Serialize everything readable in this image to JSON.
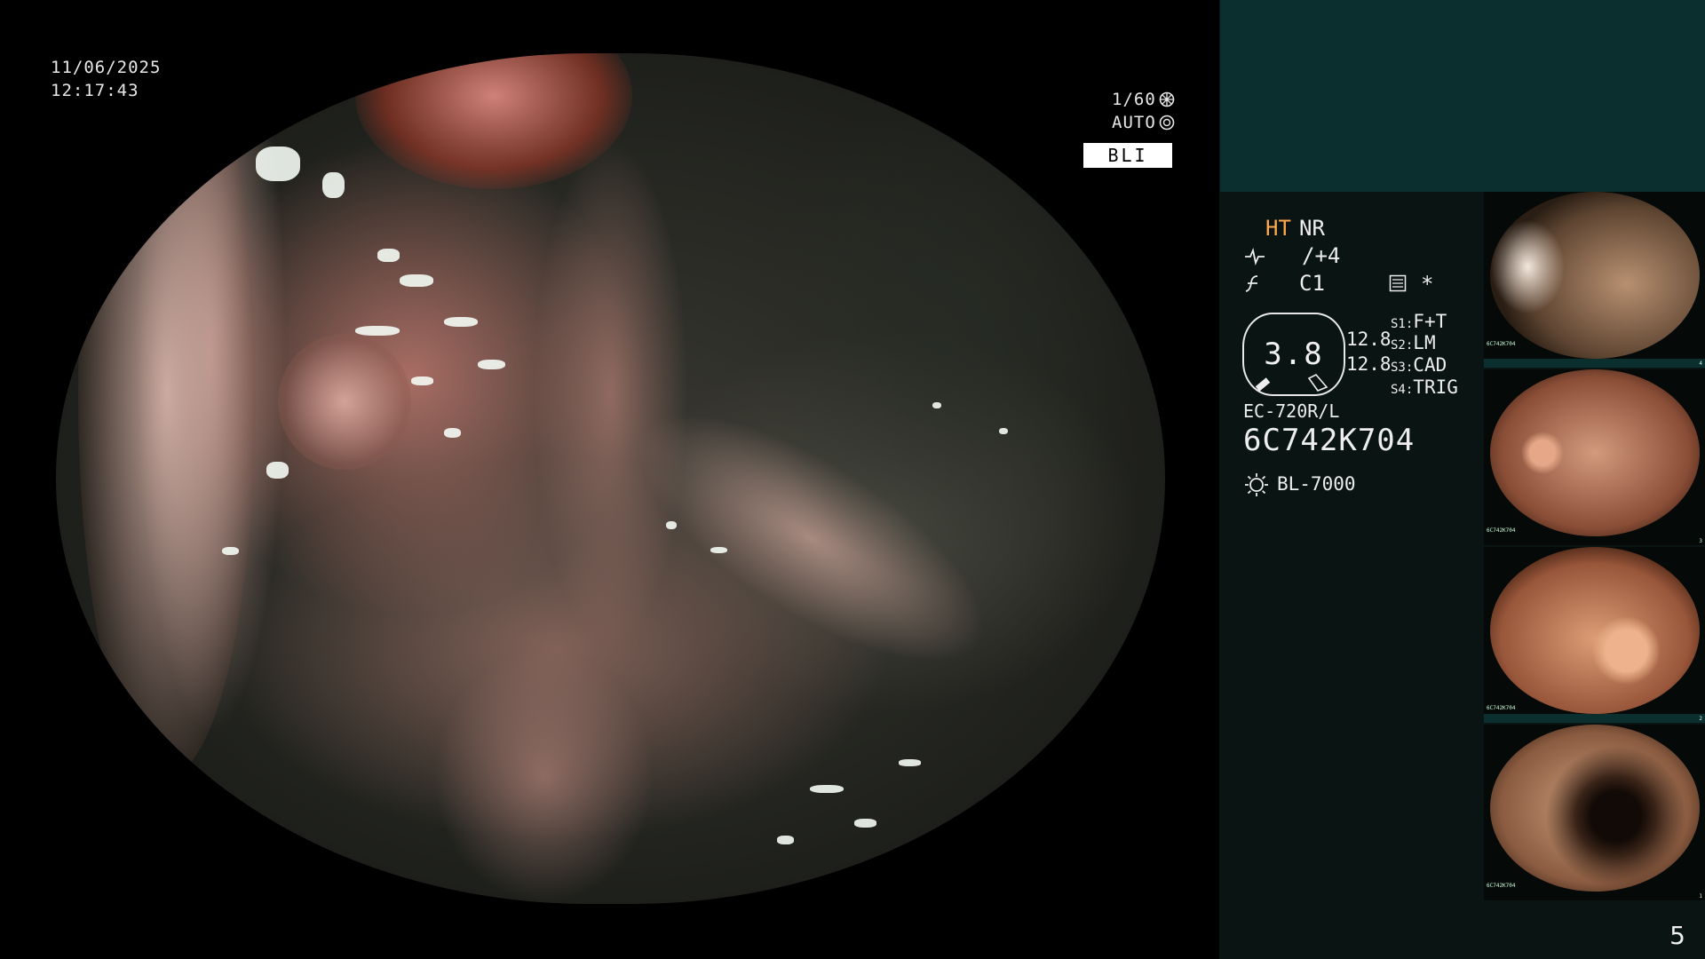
{
  "main": {
    "date": "11/06/2025",
    "time": "12:17:43",
    "shutter": "1/60",
    "exposure": "AUTO",
    "mode": "BLI"
  },
  "panel": {
    "ht": "HT",
    "nr": "NR",
    "edge": "/+4",
    "color": "C1",
    "asterisk": "*",
    "gauge_value": "3.8",
    "val1": "12.8",
    "val2": "12.8",
    "s1_key": "S1",
    "s1": "F+T",
    "s2_key": "S2",
    "s2": "LM",
    "s3_key": "S3",
    "s3": "CAD",
    "s4_key": "S4",
    "s4": "TRIG",
    "scope_model": "EC-720R/L",
    "scope_serial": "6C742K704",
    "light_source": "BL-7000"
  },
  "thumbnails": [
    {
      "serial": "6C742K704",
      "index": "4"
    },
    {
      "serial": "6C742K704",
      "index": "3"
    },
    {
      "serial": "6C742K704",
      "index": "2"
    },
    {
      "serial": "6C742K704",
      "index": "1"
    }
  ],
  "page_number": "5",
  "icons": {
    "shutter": "aperture-icon",
    "exposure": "auto-exposure-icon",
    "edge": "edge-enhance-icon",
    "color": "color-mode-icon",
    "menu": "settings-list-icon",
    "light": "light-source-icon"
  }
}
